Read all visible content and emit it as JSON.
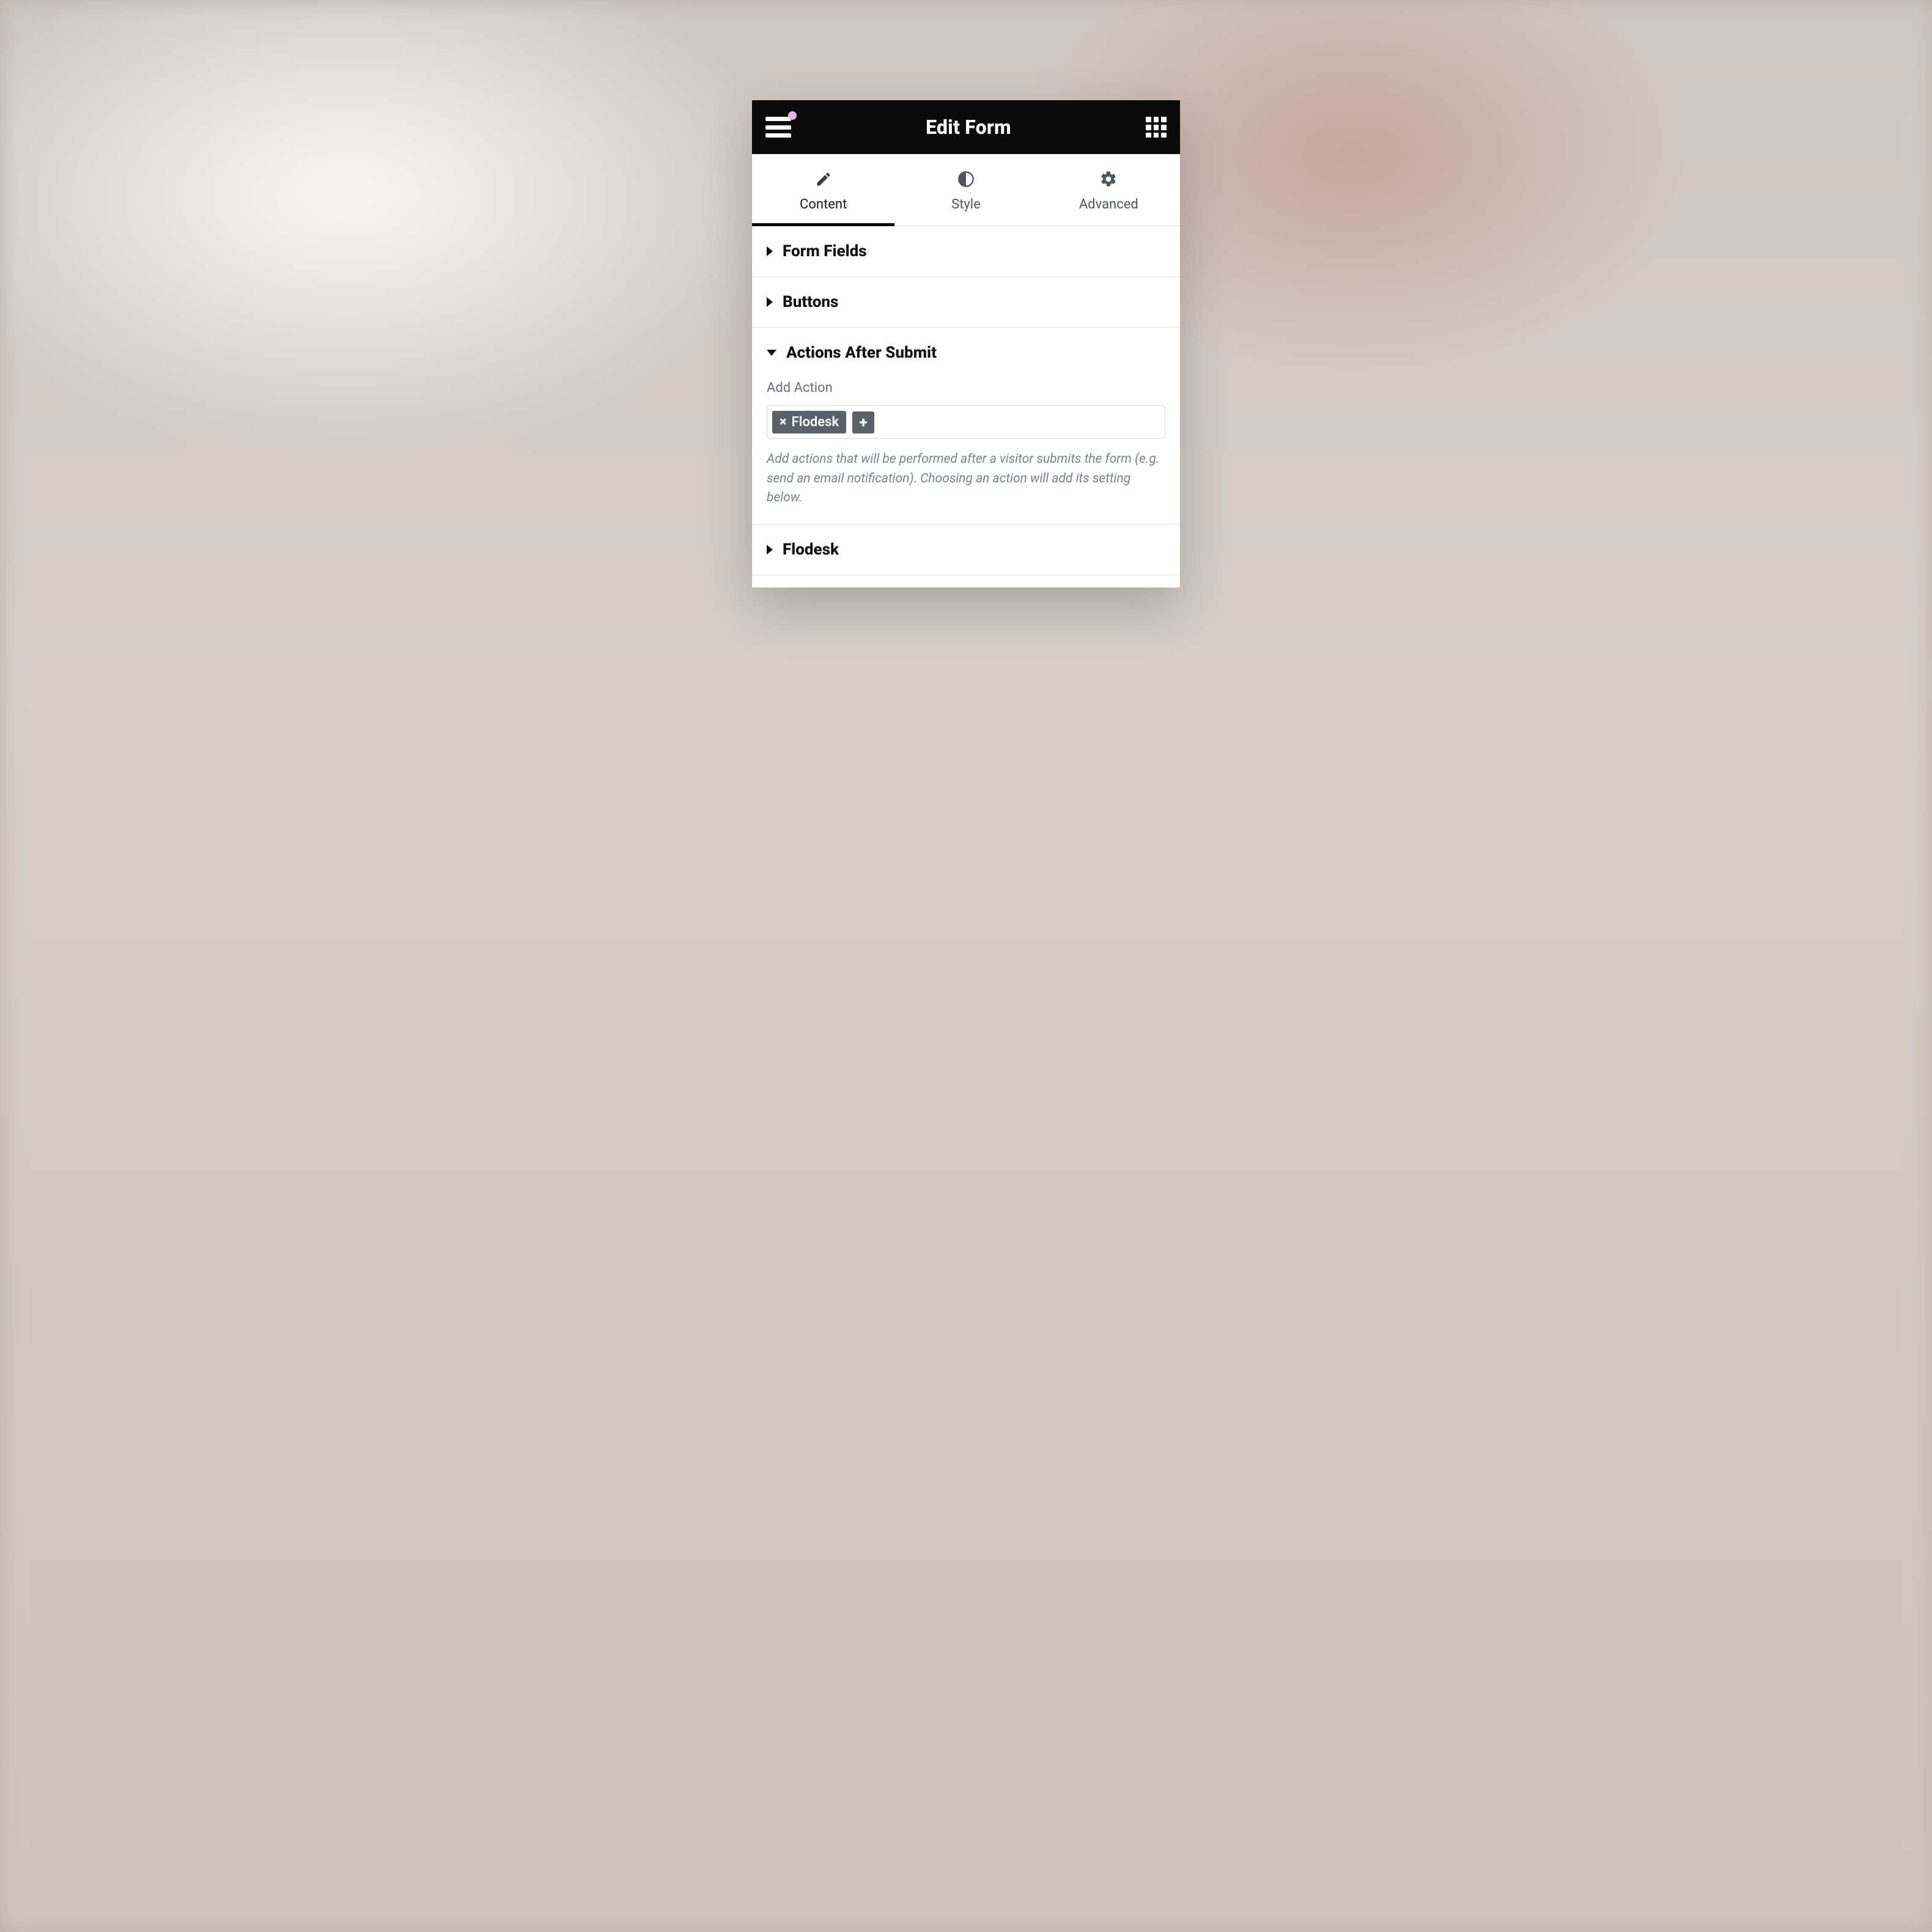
{
  "header": {
    "title": "Edit Form"
  },
  "tabs": [
    {
      "label": "Content",
      "icon": "pencil-icon",
      "active": true
    },
    {
      "label": "Style",
      "icon": "contrast-icon",
      "active": false
    },
    {
      "label": "Advanced",
      "icon": "gear-icon",
      "active": false
    }
  ],
  "sections": {
    "form_fields": {
      "title": "Form Fields"
    },
    "buttons": {
      "title": "Buttons"
    },
    "actions_after_submit": {
      "title": "Actions After Submit",
      "field_label": "Add Action",
      "tags": [
        {
          "label": "Flodesk"
        }
      ],
      "help": "Add actions that will be performed after a visitor submits the form (e.g. send an email notification). Choosing an action will add its setting below."
    },
    "flodesk": {
      "title": "Flodesk"
    }
  }
}
